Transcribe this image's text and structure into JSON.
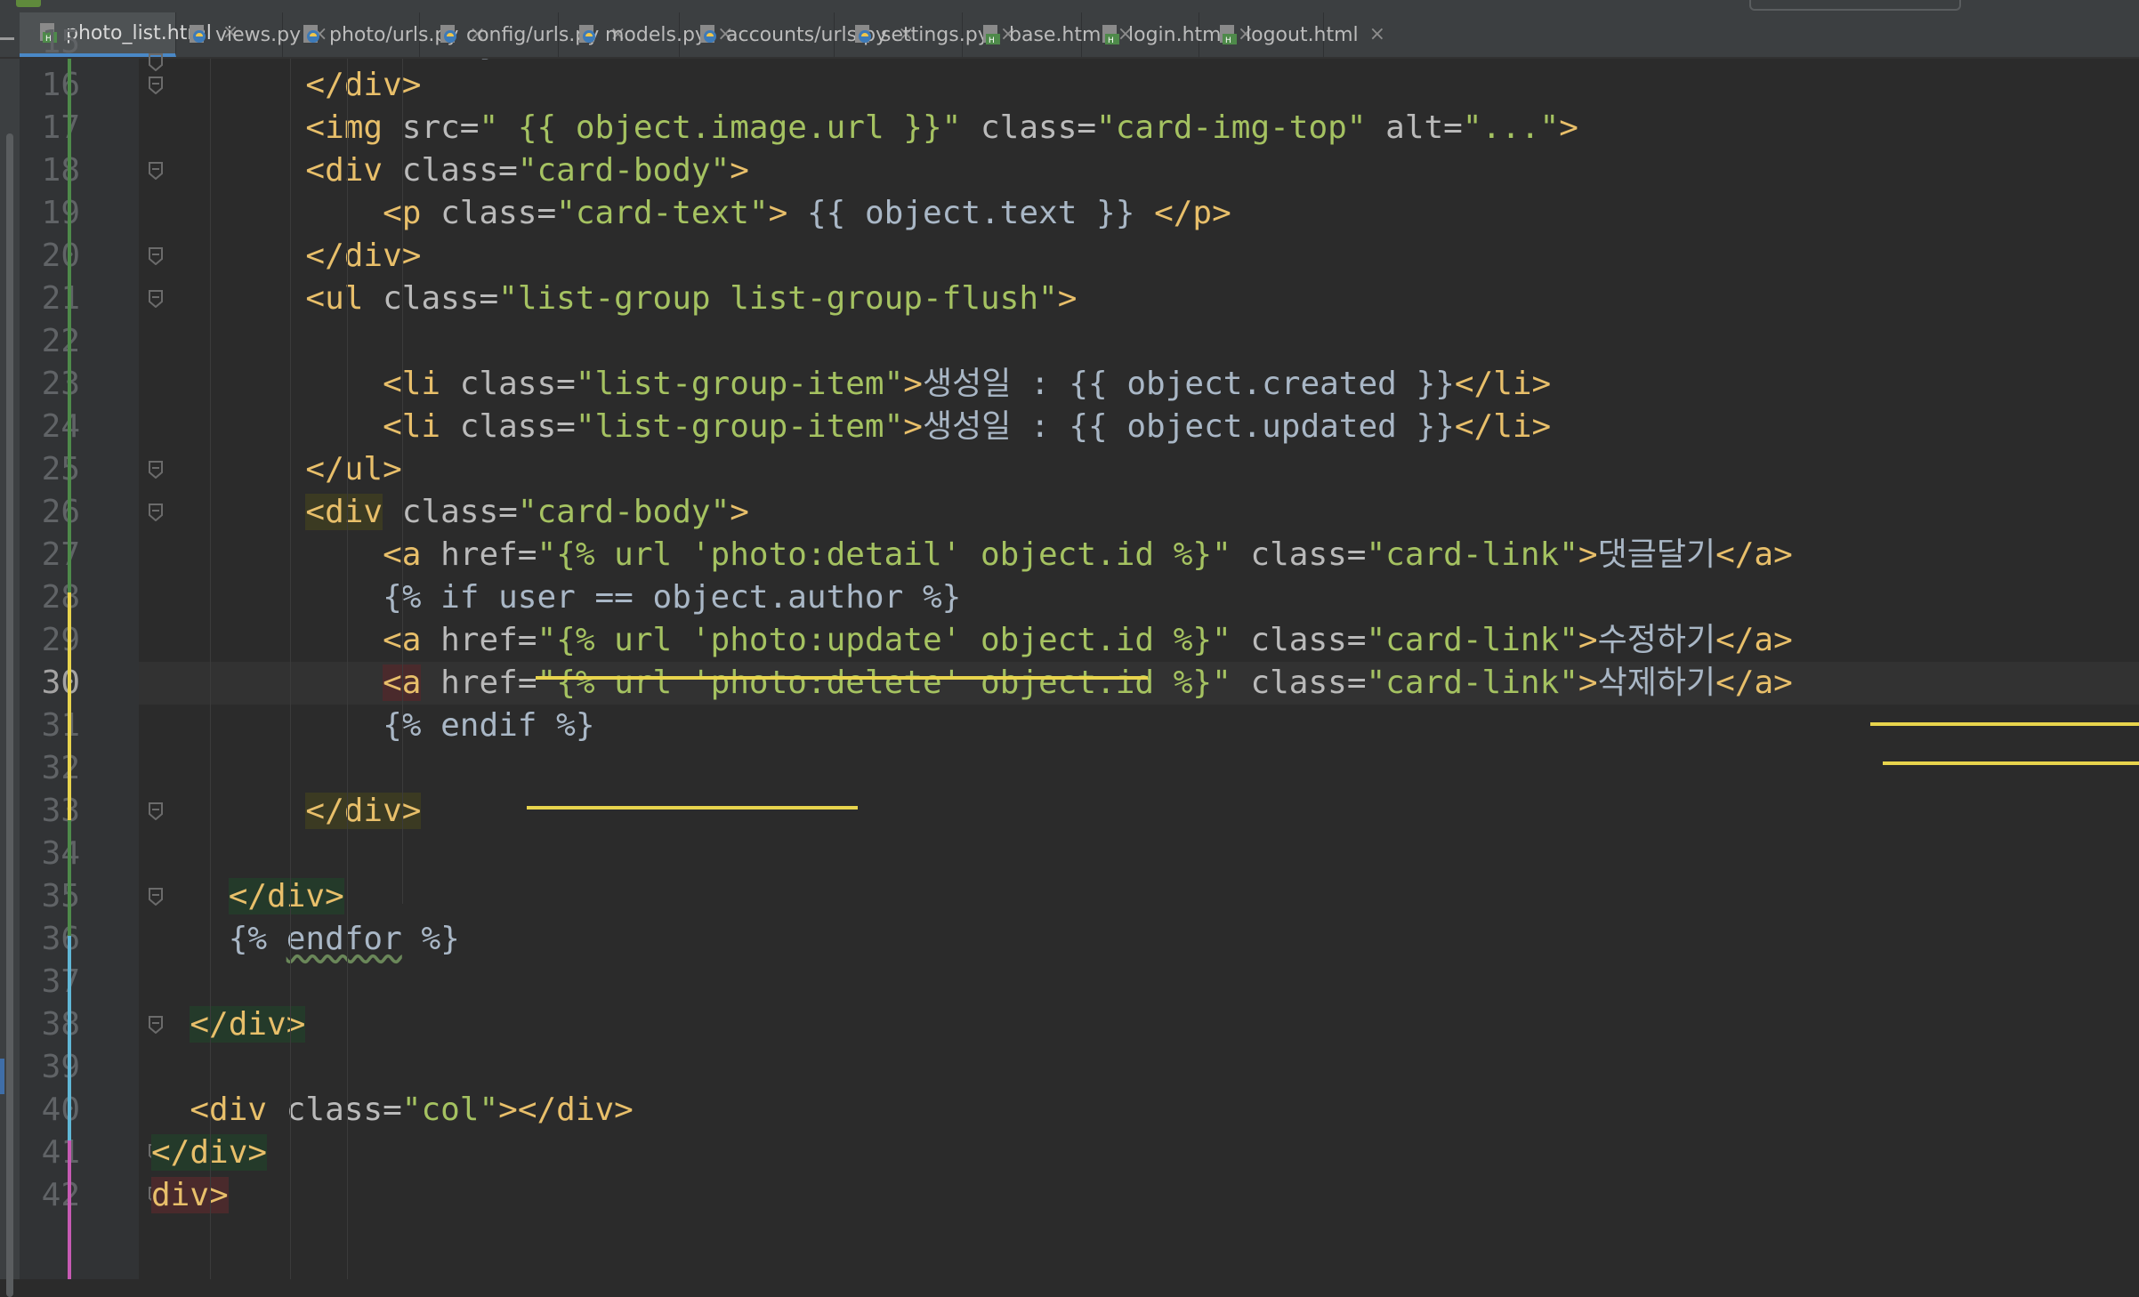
{
  "tabs": [
    {
      "label": "photo_list.html",
      "icon": "html-file-icon",
      "active": true
    },
    {
      "label": "views.py",
      "icon": "python-file-icon"
    },
    {
      "label": "photo/urls.py",
      "icon": "python-file-icon"
    },
    {
      "label": "config/urls.py",
      "icon": "python-file-icon"
    },
    {
      "label": "models.py",
      "icon": "python-file-icon"
    },
    {
      "label": "accounts/urls.py",
      "icon": "python-file-icon"
    },
    {
      "label": "settings.py",
      "icon": "python-file-icon"
    },
    {
      "label": "base.html",
      "icon": "html-file-icon"
    },
    {
      "label": "login.html",
      "icon": "html-file-icon"
    },
    {
      "label": "logout.html",
      "icon": "html-file-icon"
    }
  ],
  "close_glyph": "×",
  "current_line": 30,
  "colors": {
    "tag": "#e8bf6a",
    "attr": "#bababa",
    "value": "#a5c261",
    "text": "#a9b7c6",
    "background": "#2b2b2b",
    "gutter": "#313335",
    "underline": "#e8d44d",
    "active_tab_accent": "#4a88c7"
  },
  "lines": [
    {
      "n": 15,
      "tokens": [
        [
          "plain",
          "            {{ object.author }}"
        ]
      ]
    },
    {
      "n": 16,
      "tokens": [
        [
          "tag",
          "        </div>"
        ]
      ]
    },
    {
      "n": 17,
      "tokens": [
        [
          "tag",
          "        <img "
        ],
        [
          "attr",
          "src="
        ],
        [
          "val",
          "\" {{ object.image.url }}\""
        ],
        [
          "attr",
          " class="
        ],
        [
          "val",
          "\"card-img-top\""
        ],
        [
          "attr",
          " alt="
        ],
        [
          "val",
          "\"...\""
        ],
        [
          "tag",
          ">"
        ]
      ]
    },
    {
      "n": 18,
      "tokens": [
        [
          "tag",
          "        <div "
        ],
        [
          "attr",
          "class="
        ],
        [
          "val",
          "\"card-body\""
        ],
        [
          "tag",
          ">"
        ]
      ]
    },
    {
      "n": 19,
      "tokens": [
        [
          "tag",
          "            <p "
        ],
        [
          "attr",
          "class="
        ],
        [
          "val",
          "\"card-text\""
        ],
        [
          "tag",
          ">"
        ],
        [
          "plain",
          " {{ object.text }} "
        ],
        [
          "tag",
          "</p>"
        ]
      ]
    },
    {
      "n": 20,
      "tokens": [
        [
          "tag",
          "        </div>"
        ]
      ]
    },
    {
      "n": 21,
      "tokens": [
        [
          "tag",
          "        <ul "
        ],
        [
          "attr",
          "class="
        ],
        [
          "val",
          "\"list-group list-group-flush\""
        ],
        [
          "tag",
          ">"
        ]
      ]
    },
    {
      "n": 22,
      "tokens": []
    },
    {
      "n": 23,
      "tokens": [
        [
          "tag",
          "            <li "
        ],
        [
          "attr",
          "class="
        ],
        [
          "val",
          "\"list-group-item\""
        ],
        [
          "tag",
          ">"
        ],
        [
          "plain",
          "생성일 : {{ object.created }}"
        ],
        [
          "tag",
          "</li>"
        ]
      ]
    },
    {
      "n": 24,
      "tokens": [
        [
          "tag",
          "            <li "
        ],
        [
          "attr",
          "class="
        ],
        [
          "val",
          "\"list-group-item\""
        ],
        [
          "tag",
          ">"
        ],
        [
          "plain",
          "생성일 : {{ object.updated }}"
        ],
        [
          "tag",
          "</li>"
        ]
      ]
    },
    {
      "n": 25,
      "tokens": [
        [
          "tag",
          "        </ul>"
        ]
      ]
    },
    {
      "n": 26,
      "tokens": [
        [
          "plain",
          "        "
        ],
        [
          "tag-hl",
          "<div"
        ],
        [
          "tag",
          " "
        ],
        [
          "attr",
          "class="
        ],
        [
          "val",
          "\"card-body\""
        ],
        [
          "tag",
          ">"
        ]
      ]
    },
    {
      "n": 27,
      "tokens": [
        [
          "tag",
          "            <a "
        ],
        [
          "attr",
          "href="
        ],
        [
          "val",
          "\"{% url 'photo:detail' object.id %}\""
        ],
        [
          "attr",
          " class="
        ],
        [
          "val",
          "\"card-link\""
        ],
        [
          "tag",
          ">"
        ],
        [
          "plain",
          "댓글달기"
        ],
        [
          "tag",
          "</a>"
        ]
      ]
    },
    {
      "n": 28,
      "tokens": [
        [
          "plain",
          "            {% if user == object.author %}"
        ]
      ]
    },
    {
      "n": 29,
      "tokens": [
        [
          "tag",
          "            <a "
        ],
        [
          "attr",
          "href="
        ],
        [
          "val",
          "\"{% url 'photo:update' object.id %}\""
        ],
        [
          "attr",
          " class="
        ],
        [
          "val",
          "\"card-link\""
        ],
        [
          "tag",
          ">"
        ],
        [
          "plain",
          "수정하기"
        ],
        [
          "tag",
          "</a>"
        ]
      ]
    },
    {
      "n": 30,
      "tokens": [
        [
          "plain",
          "            "
        ],
        [
          "tag-hlr",
          "<a"
        ],
        [
          "tag",
          " "
        ],
        [
          "attr",
          "href="
        ],
        [
          "val",
          "\"{% url 'photo:delete' object.id %}\""
        ],
        [
          "attr",
          " class="
        ],
        [
          "val",
          "\"card-link\""
        ],
        [
          "tag",
          ">"
        ],
        [
          "plain",
          "삭제하기"
        ],
        [
          "tag",
          "</a>"
        ]
      ]
    },
    {
      "n": 31,
      "tokens": [
        [
          "plain",
          "            {% endif %}"
        ]
      ]
    },
    {
      "n": 32,
      "tokens": []
    },
    {
      "n": 33,
      "tokens": [
        [
          "plain",
          "        "
        ],
        [
          "tag-hl",
          "</div>"
        ]
      ]
    },
    {
      "n": 34,
      "tokens": []
    },
    {
      "n": 35,
      "tokens": [
        [
          "plain",
          "    "
        ],
        [
          "tag-hlg",
          "</div>"
        ]
      ]
    },
    {
      "n": 36,
      "tokens": [
        [
          "plain",
          "    {% "
        ],
        [
          "wavy",
          "endfor"
        ],
        [
          "plain",
          " %}"
        ]
      ]
    },
    {
      "n": 37,
      "tokens": []
    },
    {
      "n": 38,
      "tokens": [
        [
          "plain",
          "  "
        ],
        [
          "tag-hlg",
          "</div>"
        ]
      ]
    },
    {
      "n": 39,
      "tokens": []
    },
    {
      "n": 40,
      "tokens": [
        [
          "tag",
          "  <div "
        ],
        [
          "attr",
          "class="
        ],
        [
          "val",
          "\"col\""
        ],
        [
          "tag",
          "></div>"
        ]
      ]
    },
    {
      "n": 41,
      "tokens": [
        [
          "tag-hlg",
          "</div>"
        ]
      ]
    },
    {
      "n": 42,
      "tokens": [
        [
          "tag-hlr",
          "div>"
        ]
      ]
    }
  ]
}
